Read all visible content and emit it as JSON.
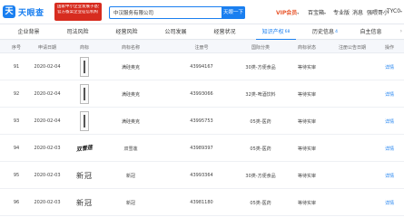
{
  "header": {
    "logo_text": "天眼查",
    "logo_mark": "天",
    "promo_lines": [
      "国家中小企业发展子基金旗下",
      "官方备案企业征信机构"
    ],
    "search_value": "中汉服务有限公司",
    "search_button": "天眼一下",
    "nav": {
      "vip": "VIP会员",
      "vip_caret": "▾",
      "enterprise": "百宝箱",
      "enterprise_caret": "▾",
      "pro": "专业版",
      "message": "消息",
      "phone": "强喂哥小",
      "user": "TYC0",
      "user_caret": "▾"
    }
  },
  "tabs": [
    {
      "label": "企业背景",
      "count": ""
    },
    {
      "label": "司法风险",
      "count": ""
    },
    {
      "label": "经营风险",
      "count": ""
    },
    {
      "label": "公司发展",
      "count": ""
    },
    {
      "label": "经营状况",
      "count": ""
    },
    {
      "label": "知识产权",
      "count": "68"
    },
    {
      "label": "历史信息",
      "count": "4"
    },
    {
      "label": "自主信息",
      "count": ""
    }
  ],
  "tab_arrow": "›",
  "table": {
    "columns": [
      "序号",
      "申请日期",
      "商标",
      "商标名称",
      "注册号",
      "国际分类",
      "商标状态",
      "注册公告日期",
      "操作"
    ],
    "rows": [
      {
        "no": "91",
        "date": "2020-02-04",
        "mark_type": "box",
        "mark_text": "",
        "name": "满硅奥克",
        "reg": "43994167",
        "class": "30类-方便食品",
        "status": "等待实审",
        "notice": "",
        "action": "详情"
      },
      {
        "no": "92",
        "date": "2020-02-04",
        "mark_type": "box",
        "mark_text": "",
        "name": "满硅奥克",
        "reg": "43993066",
        "class": "32类-啤酒饮料",
        "status": "等待实审",
        "notice": "",
        "action": "详情"
      },
      {
        "no": "93",
        "date": "2020-02-04",
        "mark_type": "box",
        "mark_text": "",
        "name": "满硅奥克",
        "reg": "43995753",
        "class": "05类-医药",
        "status": "等待实审",
        "notice": "",
        "action": "详情"
      },
      {
        "no": "94",
        "date": "2020-02-03",
        "mark_type": "ink",
        "mark_text": "双雪莲",
        "name": "双雪莲",
        "reg": "43989397",
        "class": "05类-医药",
        "status": "等待实审",
        "notice": "",
        "action": "详情"
      },
      {
        "no": "95",
        "date": "2020-02-03",
        "mark_type": "serif",
        "mark_text": "新冠",
        "name": "新冠",
        "reg": "43993364",
        "class": "30类-方便食品",
        "status": "等待实审",
        "notice": "",
        "action": "详情"
      },
      {
        "no": "96",
        "date": "2020-02-03",
        "mark_type": "serif",
        "mark_text": "新冠",
        "name": "新冠",
        "reg": "43981180",
        "class": "05类-医药",
        "status": "等待实审",
        "notice": "",
        "action": "详情"
      }
    ]
  }
}
